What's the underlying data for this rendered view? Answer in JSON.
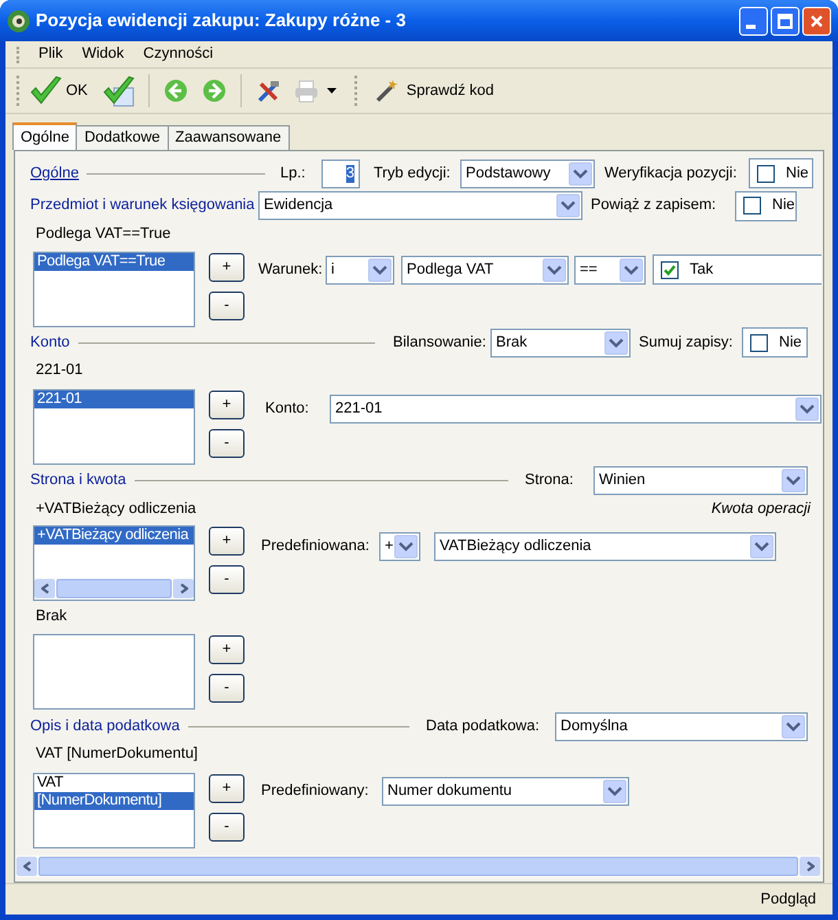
{
  "window": {
    "title": "Pozycja ewidencji zakupu: Zakupy różne - 3"
  },
  "menu": [
    {
      "label": "Plik"
    },
    {
      "label": "Widok"
    },
    {
      "label": "Czynności"
    }
  ],
  "toolbar": [
    {
      "kind": "ok",
      "label": "OK"
    },
    {
      "kind": "save"
    },
    {
      "kind": "back"
    },
    {
      "kind": "forward"
    },
    {
      "kind": "tools"
    },
    {
      "kind": "print",
      "disabled": true
    },
    {
      "kind": "check_code",
      "label": "Sprawdź kod"
    }
  ],
  "tabs": [
    {
      "label": "Ogólne",
      "selected": true
    },
    {
      "label": "Dodatkowe",
      "selected": false
    },
    {
      "label": "Zaawansowane",
      "selected": false
    }
  ],
  "general": {
    "heading": {
      "text": "Ogólne",
      "focused": true
    },
    "lp": {
      "label": "Lp.:",
      "value": "3"
    },
    "edit_mode": {
      "label": "Tryb edycji:",
      "value": "Podstawowy"
    },
    "verification": {
      "label": "Weryfikacja pozycji:",
      "option": "Nie",
      "checked": false
    }
  },
  "subject": {
    "heading": {
      "text": "Przedmiot i warunek księgowania",
      "focused": false
    },
    "value": "Ewidencja",
    "link": {
      "label": "Powiąż z zapisem:",
      "option": "Nie",
      "checked": false
    },
    "caption": "Podlega VAT==True",
    "items": [
      {
        "text": "Podlega VAT==True",
        "selected": true
      }
    ],
    "buttons": [
      "+",
      "-"
    ],
    "condition": {
      "label": "Warunek:",
      "operator": "i",
      "field": "Podlega VAT",
      "comparison": "==",
      "option": "Tak",
      "checked": true
    }
  },
  "account": {
    "heading": {
      "text": "Konto",
      "focused": false
    },
    "balancing": {
      "label": "Bilansowanie:",
      "value": "Brak"
    },
    "sum": {
      "label": "Sumuj zapisy:",
      "option": "Nie",
      "checked": false
    },
    "caption": "221-01",
    "items": [
      {
        "text": "221-01",
        "selected": true
      }
    ],
    "buttons": [
      "+",
      "-"
    ],
    "account_field": {
      "label": "Konto:",
      "value": "221-01"
    }
  },
  "side_amount": {
    "heading": {
      "text": "Strona i kwota",
      "focused": false
    },
    "side": {
      "label": "Strona:",
      "value": "Winien"
    },
    "caption": "+VATBieżący odliczenia",
    "note": "Kwota operacji",
    "items": [
      {
        "text": "+VATBieżący odliczenia",
        "selected": true
      }
    ],
    "buttons": [
      "+",
      "-"
    ],
    "predefined": {
      "label": "Predefiniowana:",
      "sign": "+",
      "value": "VATBieżący odliczenia"
    },
    "caption_2": "Brak",
    "buttons_2": [
      "+",
      "-"
    ]
  },
  "description": {
    "heading": {
      "text": "Opis i data podatkowa",
      "focused": false
    },
    "tax_date": {
      "label": "Data podatkowa:",
      "value": "Domyślna"
    },
    "caption": "VAT [NumerDokumentu]",
    "items": [
      {
        "text": "VAT",
        "selected": false
      },
      {
        "text": "[NumerDokumentu]",
        "selected": true
      }
    ],
    "buttons": [
      "+",
      "-"
    ],
    "predefined": {
      "label": "Predefiniowany:",
      "value": "Numer dokumentu"
    }
  },
  "status_bar": {
    "text": "Podgląd"
  }
}
